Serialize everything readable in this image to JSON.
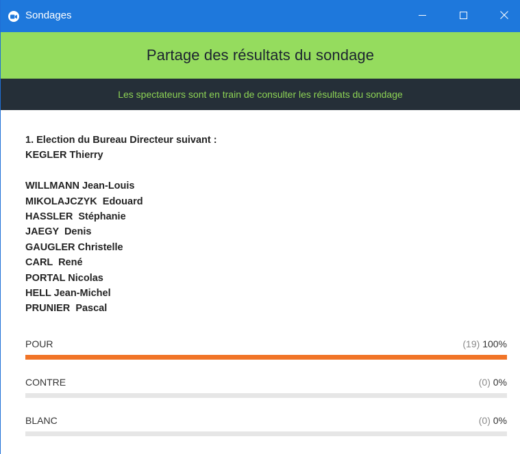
{
  "window": {
    "title": "Sondages",
    "minimize_icon": "minimize-icon",
    "maximize_icon": "maximize-icon",
    "close_icon": "close-icon",
    "app_icon": "zoom-camera-icon",
    "titlebar_color": "#1e78dc"
  },
  "header": {
    "title": "Partage des résultats du sondage",
    "color": "#95dc5e"
  },
  "banner": {
    "text": "Les spectateurs sont en train de consulter les résultats du sondage",
    "background": "#252f38",
    "text_color": "#8ed455"
  },
  "question": {
    "lines": [
      "1. Election du Bureau Directeur suivant :",
      "KEGLER Thierry",
      "",
      "WILLMANN Jean-Louis",
      "MIKOLAJCZYK  Edouard",
      "HASSLER  Stéphanie",
      "JAEGY  Denis",
      "GAUGLER Christelle",
      "CARL  René",
      "PORTAL Nicolas",
      "HELL Jean-Michel",
      "PRUNIER  Pascal"
    ]
  },
  "answers": [
    {
      "label": "POUR",
      "count": "(19)",
      "percent": "100%",
      "fraction": 1.0
    },
    {
      "label": "CONTRE",
      "count": "(0)",
      "percent": "0%",
      "fraction": 0.0
    },
    {
      "label": "BLANC",
      "count": "(0)",
      "percent": "0%",
      "fraction": 0.0
    }
  ],
  "bar_color": "#f17427"
}
